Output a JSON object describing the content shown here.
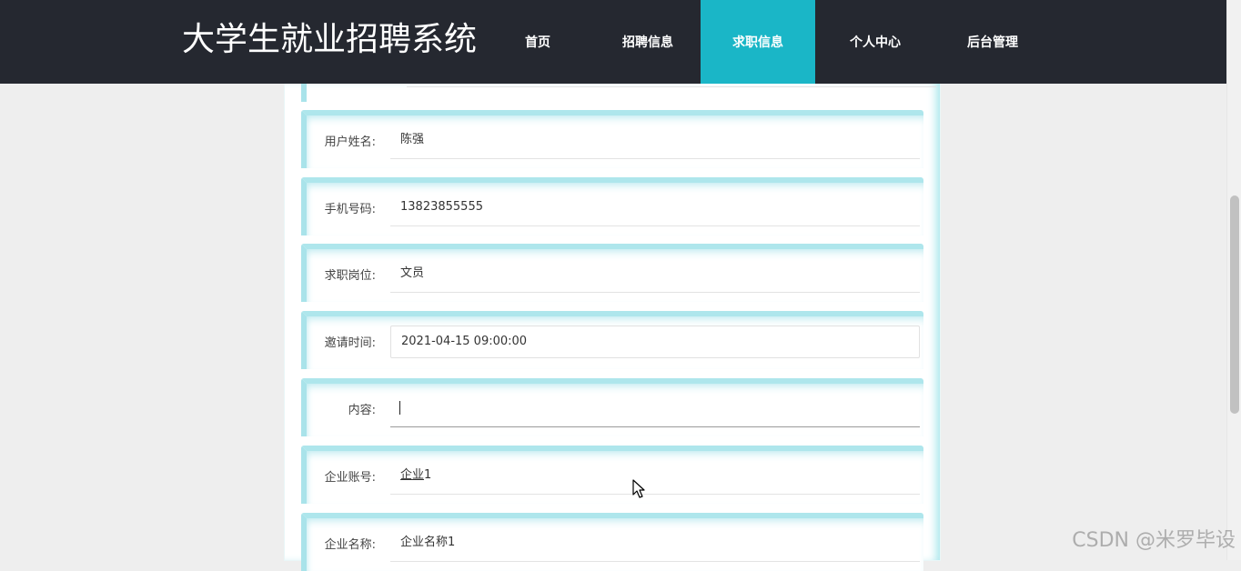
{
  "header": {
    "site_title": "大学生就业招聘系统",
    "nav": [
      {
        "label": "首页",
        "active": false
      },
      {
        "label": "招聘信息",
        "active": false
      },
      {
        "label": "求职信息",
        "active": true
      },
      {
        "label": "个人中心",
        "active": false
      },
      {
        "label": "后台管理",
        "active": false
      }
    ]
  },
  "form": {
    "fields": [
      {
        "label": "用户姓名:",
        "value": "陈强"
      },
      {
        "label": "手机号码:",
        "value": "13823855555"
      },
      {
        "label": "求职岗位:",
        "value": "文员"
      },
      {
        "label": "邀请时间:",
        "value": "2021-04-15 09:00:00"
      },
      {
        "label": "内容:",
        "value": ""
      },
      {
        "label": "企业账号:",
        "value_underlined": "企业",
        "value_rest": "1"
      },
      {
        "label": "企业名称:",
        "value": "企业名称1"
      }
    ]
  },
  "colors": {
    "header_bg": "#252830",
    "nav_active_bg": "#1ab6c7",
    "row_accent": "#a9e3ea",
    "page_bg": "#eeeeee"
  },
  "watermark": "CSDN @米罗毕设",
  "icons": {
    "cursor": "mouse-pointer-icon"
  }
}
